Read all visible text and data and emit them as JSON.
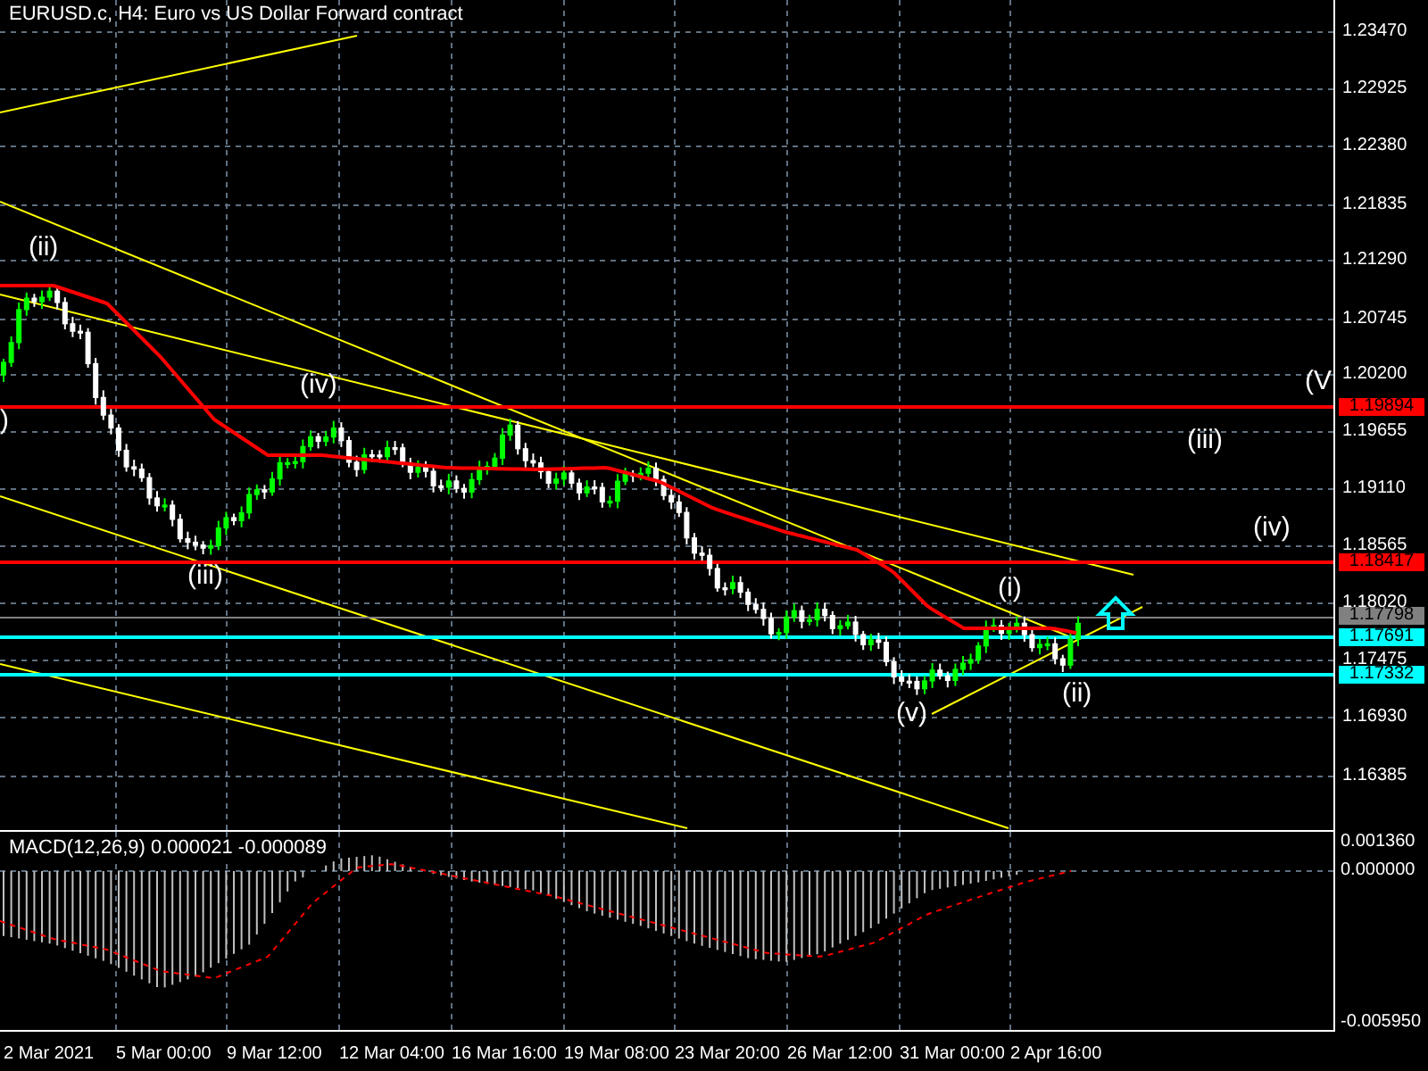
{
  "window": {
    "title": "EURUSD.c, H4:  Euro vs US Dollar Forward contract"
  },
  "price_axis": {
    "labels": [
      "1.23470",
      "1.22925",
      "1.22380",
      "1.21835",
      "1.21290",
      "1.20745",
      "1.20200",
      "1.19655",
      "1.19110",
      "1.18565",
      "1.18020",
      "1.17475",
      "1.16930",
      "1.16385"
    ]
  },
  "price_tags": [
    {
      "value": "1.19894",
      "color": "#ff0000"
    },
    {
      "value": "1.18417",
      "color": "#ff0000"
    },
    {
      "value": "1.17798",
      "color": "#808080"
    },
    {
      "value": "1.17691",
      "color": "#00ffff"
    },
    {
      "value": "1.17332",
      "color": "#00ffff"
    }
  ],
  "wave_labels": [
    "(ii)",
    "(iv)",
    "(iii)",
    "(i)",
    "(v)",
    "(ii)",
    "(iii)",
    "(iv)",
    "(V",
    ")"
  ],
  "indicator": {
    "label": "MACD(12,26,9) 0.000021 -0.000089",
    "axis_labels": [
      "0.001360",
      "0.000000",
      "-0.005950"
    ]
  },
  "time_axis": {
    "labels": [
      "2 Mar 2021",
      "5 Mar 00:00",
      "9 Mar 12:00",
      "12 Mar 04:00",
      "16 Mar 16:00",
      "19 Mar 08:00",
      "23 Mar 20:00",
      "26 Mar 12:00",
      "31 Mar 00:00",
      "2 Apr 16:00"
    ]
  }
}
